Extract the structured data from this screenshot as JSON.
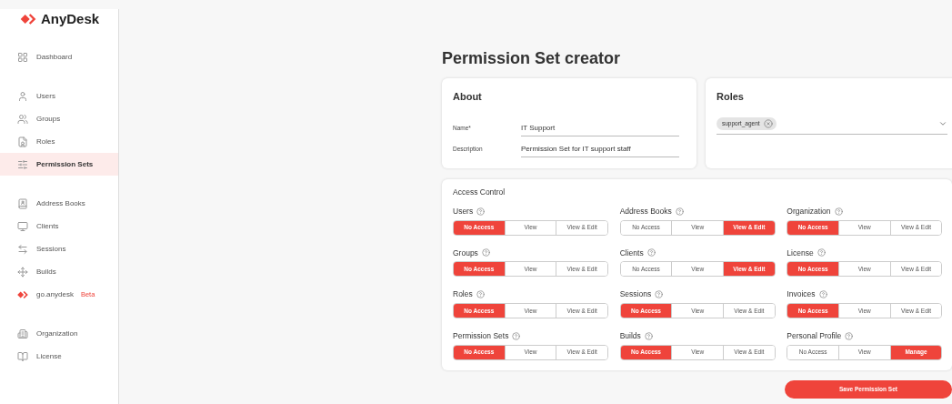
{
  "sidebar": {
    "logo": "AnyDesk",
    "groups": [
      [
        {
          "label": "Dashboard",
          "selected": false
        }
      ],
      [
        {
          "label": "Users",
          "selected": false
        },
        {
          "label": "Groups",
          "selected": false
        },
        {
          "label": "Roles",
          "selected": false
        },
        {
          "label": "Permission Sets",
          "selected": true
        }
      ],
      [
        {
          "label": "Address Books",
          "selected": false
        },
        {
          "label": "Clients",
          "selected": false
        },
        {
          "label": "Sessions",
          "selected": false
        },
        {
          "label": "Builds",
          "selected": false
        },
        {
          "label": "go.anydesk",
          "selected": false,
          "badge": "Beta"
        }
      ],
      [
        {
          "label": "Organization",
          "selected": false
        },
        {
          "label": "License",
          "selected": false
        }
      ]
    ]
  },
  "title": "Permission Set creator",
  "about": {
    "title": "About",
    "fields": [
      {
        "label": "Name*",
        "value": "IT Support"
      },
      {
        "label": "Description",
        "value": "Permission Set for IT support staff"
      }
    ]
  },
  "roles": {
    "title": "Roles",
    "chips": [
      "support_agent"
    ]
  },
  "access_control": {
    "title": "Access Control",
    "permissions": [
      {
        "label": "Users",
        "options": [
          {
            "label": "No Access",
            "selected": true
          },
          {
            "label": "View",
            "selected": false
          },
          {
            "label": "View & Edit",
            "selected": false
          }
        ]
      },
      {
        "label": "Address Books",
        "options": [
          {
            "label": "No Access",
            "selected": false
          },
          {
            "label": "View",
            "selected": false
          },
          {
            "label": "View & Edit",
            "selected": true
          }
        ]
      },
      {
        "label": "Organization",
        "options": [
          {
            "label": "No Access",
            "selected": true
          },
          {
            "label": "View",
            "selected": false
          },
          {
            "label": "View & Edit",
            "selected": false
          }
        ]
      },
      {
        "label": "Groups",
        "options": [
          {
            "label": "No Access",
            "selected": true
          },
          {
            "label": "View",
            "selected": false
          },
          {
            "label": "View & Edit",
            "selected": false
          }
        ]
      },
      {
        "label": "Clients",
        "options": [
          {
            "label": "No Access",
            "selected": false
          },
          {
            "label": "View",
            "selected": false
          },
          {
            "label": "View & Edit",
            "selected": true
          }
        ]
      },
      {
        "label": "License",
        "options": [
          {
            "label": "No Access",
            "selected": true
          },
          {
            "label": "View",
            "selected": false
          },
          {
            "label": "View & Edit",
            "selected": false
          }
        ]
      },
      {
        "label": "Roles",
        "options": [
          {
            "label": "No Access",
            "selected": true
          },
          {
            "label": "View",
            "selected": false
          },
          {
            "label": "View & Edit",
            "selected": false
          }
        ]
      },
      {
        "label": "Sessions",
        "options": [
          {
            "label": "No Access",
            "selected": true
          },
          {
            "label": "View",
            "selected": false
          },
          {
            "label": "View & Edit",
            "selected": false
          }
        ]
      },
      {
        "label": "Invoices",
        "options": [
          {
            "label": "No Access",
            "selected": true
          },
          {
            "label": "View",
            "selected": false
          },
          {
            "label": "View & Edit",
            "selected": false
          }
        ]
      },
      {
        "label": "Permission Sets",
        "options": [
          {
            "label": "No Access",
            "selected": true
          },
          {
            "label": "View",
            "selected": false
          },
          {
            "label": "View & Edit",
            "selected": false
          }
        ]
      },
      {
        "label": "Builds",
        "options": [
          {
            "label": "No Access",
            "selected": true
          },
          {
            "label": "View",
            "selected": false
          },
          {
            "label": "View & Edit",
            "selected": false
          }
        ]
      },
      {
        "label": "Personal Profile",
        "options": [
          {
            "label": "No Access",
            "selected": false
          },
          {
            "label": "View",
            "selected": false
          },
          {
            "label": "Manage",
            "selected": true
          }
        ]
      }
    ]
  },
  "save_button": "Save Permission Set"
}
